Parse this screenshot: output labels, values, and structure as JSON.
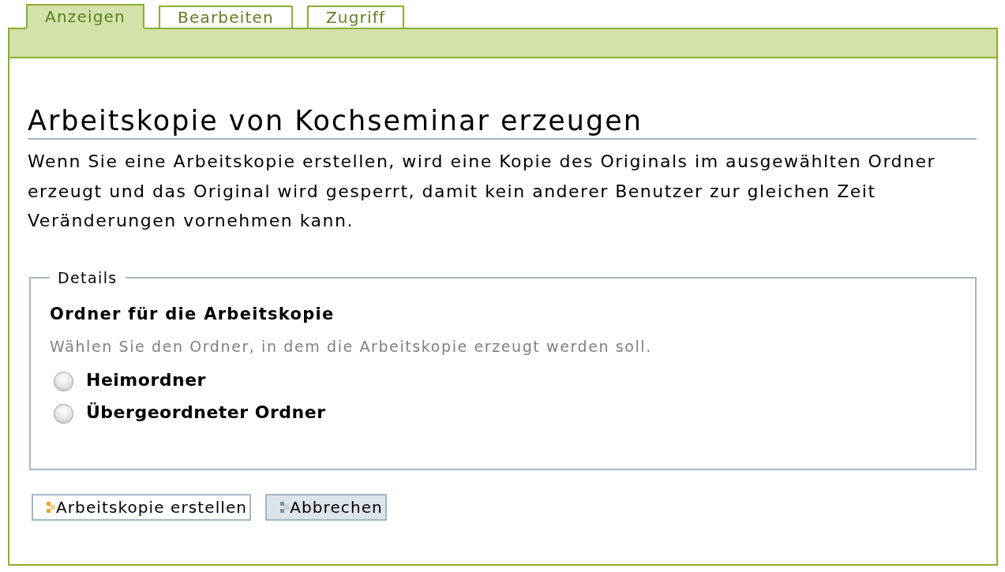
{
  "tabs": [
    {
      "label": "Anzeigen",
      "selected": true
    },
    {
      "label": "Bearbeiten",
      "selected": false
    },
    {
      "label": "Zugriff",
      "selected": false
    }
  ],
  "page": {
    "title": "Arbeitskopie von Kochseminar erzeugen",
    "description": "Wenn Sie eine Arbeitskopie erstellen, wird eine Kopie des Originals im ausgewählten Ordner erzeugt und das Original wird gesperrt, damit kein anderer Benutzer zur gleichen Zeit Veränderungen vornehmen kann."
  },
  "fieldset": {
    "legend": "Details",
    "field": {
      "label": "Ordner für die Arbeitskopie",
      "hint": "Wählen Sie den Ordner, in dem die Arbeitskopie erzeugt werden soll.",
      "options": [
        {
          "label": "Heimordner",
          "selected": false
        },
        {
          "label": "Übergeordneter Ordner",
          "selected": false
        }
      ]
    }
  },
  "buttons": [
    {
      "label": "Arbeitskopie erstellen",
      "kind": "primary"
    },
    {
      "label": "Abbrechen",
      "kind": "cancel"
    }
  ]
}
